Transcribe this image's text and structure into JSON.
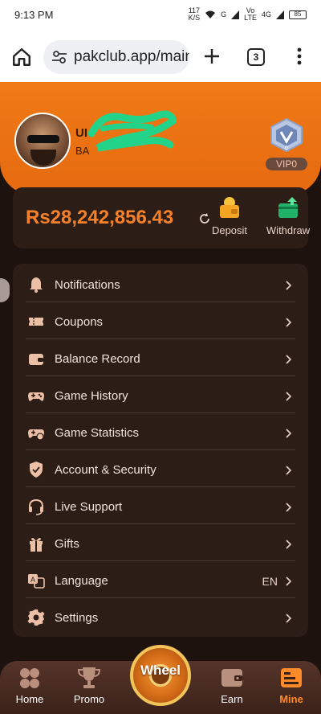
{
  "status_bar": {
    "time": "9:13 PM",
    "speed": "117",
    "speed_unit": "K/S",
    "net1": "G",
    "net2_top": "Vo",
    "net2_bottom": "LTE",
    "net3": "4G",
    "battery": "85"
  },
  "browser": {
    "url": "pakclub.app/main",
    "tab_count": "3",
    "icons": [
      "home-icon",
      "tune-icon",
      "plus-icon",
      "more-vert-icon"
    ]
  },
  "profile": {
    "name": "UI",
    "uid": "BA",
    "vip_label": "VIP0",
    "vip_level": "0"
  },
  "wallet": {
    "balance": "Rs28,242,856.43",
    "deposit_label": "Deposit",
    "withdraw_label": "Withdraw"
  },
  "menu": [
    {
      "label": "Notifications",
      "icon": "bell-icon",
      "right": ""
    },
    {
      "label": "Coupons",
      "icon": "ticket-icon",
      "right": ""
    },
    {
      "label": "Balance Record",
      "icon": "wallet-icon",
      "right": ""
    },
    {
      "label": "Game History",
      "icon": "gamepad-icon",
      "right": ""
    },
    {
      "label": "Game Statistics",
      "icon": "gamepad-stats-icon",
      "right": ""
    },
    {
      "label": "Account & Security",
      "icon": "shield-check-icon",
      "right": ""
    },
    {
      "label": "Live Support",
      "icon": "headset-icon",
      "right": ""
    },
    {
      "label": "Gifts",
      "icon": "gift-icon",
      "right": ""
    },
    {
      "label": "Language",
      "icon": "translate-icon",
      "right": "EN"
    },
    {
      "label": "Settings",
      "icon": "gear-icon",
      "right": ""
    }
  ],
  "nav": {
    "home": "Home",
    "promo": "Promo",
    "wheel": "Wheel",
    "earn": "Earn",
    "mine": "Mine",
    "active": "Mine"
  },
  "colors": {
    "accent": "#f5822a",
    "header": "#f07a16",
    "card": "#2c1d17",
    "background": "#1e120e"
  }
}
